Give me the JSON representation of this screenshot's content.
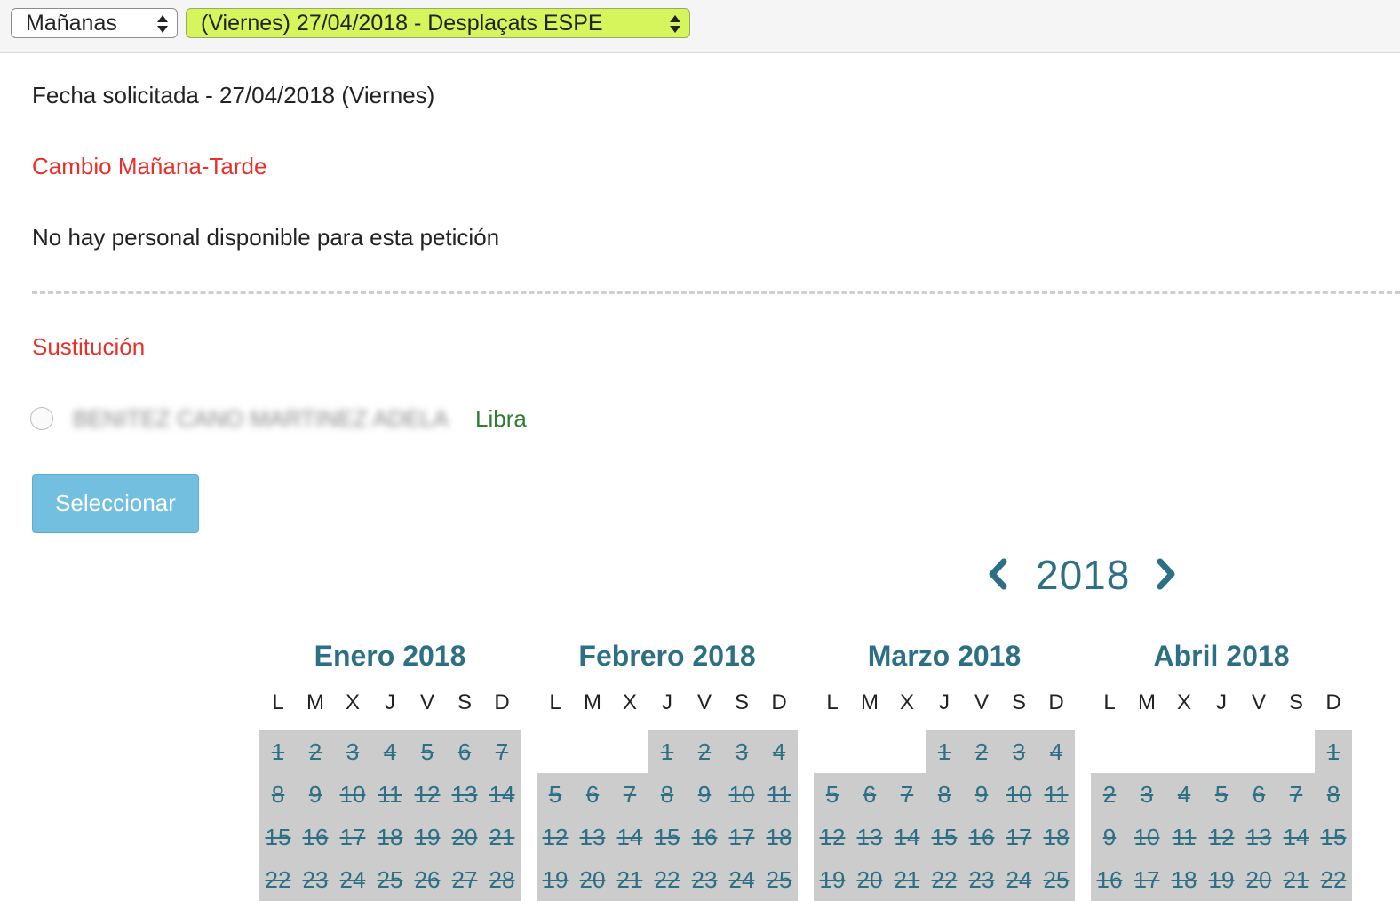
{
  "toolbar": {
    "shift_select": "Mañanas",
    "date_select": "(Viernes) 27/04/2018 - Desplaçats ESPE",
    "date_select_color": "#d6f55c"
  },
  "main": {
    "requested_date": "Fecha solicitada - 27/04/2018 (Viernes)",
    "section_change": "Cambio Mañana-Tarde",
    "no_staff_message": "No hay personal disponible para esta petición",
    "section_substitution": "Sustitución",
    "candidate_name": "BENITEZ CANO MARTINEZ ADELA",
    "candidate_status": "Libra",
    "select_button": "Seleccionar"
  },
  "calendar": {
    "year": "2018",
    "prev_icon": "chevron-left-icon",
    "next_icon": "chevron-right-icon",
    "weekday_labels": [
      "L",
      "M",
      "X",
      "J",
      "V",
      "S",
      "D"
    ],
    "months": [
      {
        "title": "Enero 2018",
        "offset": 0,
        "days": [
          "1",
          "2",
          "3",
          "4",
          "5",
          "6",
          "7",
          "8",
          "9",
          "10",
          "11",
          "12",
          "13",
          "14",
          "15",
          "16",
          "17",
          "18",
          "19",
          "20",
          "21",
          "22",
          "23",
          "24",
          "25",
          "26",
          "27",
          "28"
        ]
      },
      {
        "title": "Febrero 2018",
        "offset": 3,
        "days": [
          "1",
          "2",
          "3",
          "4",
          "5",
          "6",
          "7",
          "8",
          "9",
          "10",
          "11",
          "12",
          "13",
          "14",
          "15",
          "16",
          "17",
          "18",
          "19",
          "20",
          "21",
          "22",
          "23",
          "24",
          "25"
        ]
      },
      {
        "title": "Marzo 2018",
        "offset": 3,
        "days": [
          "1",
          "2",
          "3",
          "4",
          "5",
          "6",
          "7",
          "8",
          "9",
          "10",
          "11",
          "12",
          "13",
          "14",
          "15",
          "16",
          "17",
          "18",
          "19",
          "20",
          "21",
          "22",
          "23",
          "24",
          "25"
        ]
      },
      {
        "title": "Abril 2018",
        "offset": 6,
        "days": [
          "1",
          "2",
          "3",
          "4",
          "5",
          "6",
          "7",
          "8",
          "9",
          "10",
          "11",
          "12",
          "13",
          "14",
          "15",
          "16",
          "17",
          "18",
          "19",
          "20",
          "21",
          "22"
        ]
      }
    ]
  }
}
